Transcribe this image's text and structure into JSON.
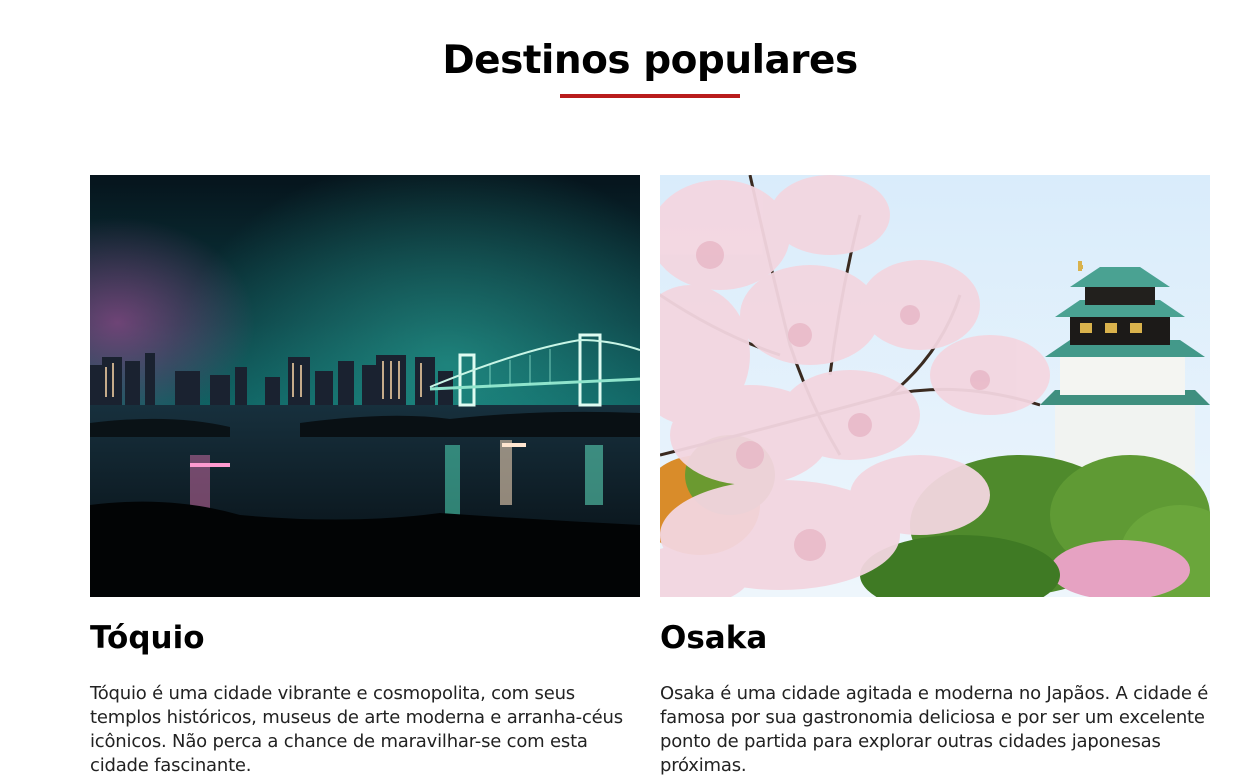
{
  "section": {
    "title": "Destinos populares"
  },
  "destinations": [
    {
      "name": "Tóquio",
      "image_icon": "tokyo-night-bay-image",
      "description": "Tóquio é uma cidade vibrante e cosmopolita, com seus templos históricos, museus de arte moderna e arranha-céus icônicos. Não perca a chance de maravilhar-se com esta cidade fascinante."
    },
    {
      "name": "Osaka",
      "image_icon": "osaka-castle-cherry-blossom-image",
      "description": "Osaka é uma cidade agitada e moderna no Japãos. A cidade é famosa por sua gastronomia deliciosa e por ser um excelente ponto de partida para explorar outras cidades japonesas próximas."
    }
  ],
  "colors": {
    "accent": "#b91c1c",
    "heading": "#000000",
    "body_text": "#222222"
  }
}
